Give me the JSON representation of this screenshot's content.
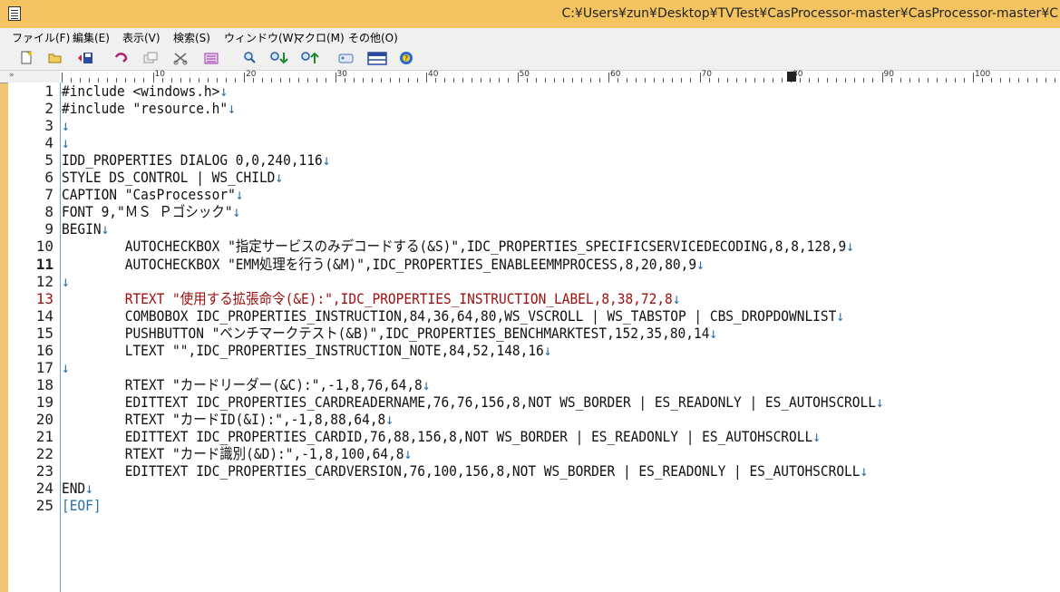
{
  "window": {
    "title": "C:¥Users¥zun¥Desktop¥TVTest¥CasProcessor-master¥CasProcessor-master¥C"
  },
  "menu": [
    {
      "label": "ファイル(F)"
    },
    {
      "label": "編集(E)"
    },
    {
      "label": "表示(V)"
    },
    {
      "label": "検索(S)"
    },
    {
      "label": "ウィンドウ(W)"
    },
    {
      "label": "マクロ(M)"
    },
    {
      "label": "その他(O)"
    }
  ],
  "toolbar": [
    {
      "icon": "new-file-icon"
    },
    {
      "icon": "open-folder-icon"
    },
    {
      "icon": "save-icon"
    },
    {
      "icon": "undo-icon"
    },
    {
      "icon": "copy-icon"
    },
    {
      "icon": "cut-icon"
    },
    {
      "icon": "paste-icon"
    },
    {
      "icon": "search-icon"
    },
    {
      "icon": "search-next-icon"
    },
    {
      "icon": "search-prev-icon"
    },
    {
      "icon": "window-icon"
    },
    {
      "icon": "split-icon"
    },
    {
      "icon": "help-icon"
    }
  ],
  "ruler": {
    "marker": "»",
    "labels": [
      "10",
      "20",
      "30",
      "40",
      "50",
      "60",
      "70",
      "80",
      "90",
      "100"
    ]
  },
  "editor": {
    "lines": [
      {
        "n": "1",
        "text": "#include <windows.h>",
        "eol": "↓"
      },
      {
        "n": "2",
        "text": "#include \"resource.h\"",
        "eol": "↓"
      },
      {
        "n": "3",
        "text": "",
        "eol": "↓"
      },
      {
        "n": "4",
        "text": "",
        "eol": "↓"
      },
      {
        "n": "5",
        "text": "IDD_PROPERTIES DIALOG 0,0,240,116",
        "eol": "↓"
      },
      {
        "n": "6",
        "text": "STYLE DS_CONTROL | WS_CHILD",
        "eol": "↓"
      },
      {
        "n": "7",
        "text": "CAPTION \"CasProcessor\"",
        "eol": "↓"
      },
      {
        "n": "8",
        "text": "FONT 9,\"ＭＳ Ｐゴシック\"",
        "eol": "↓"
      },
      {
        "n": "9",
        "text": "BEGIN",
        "eol": "↓"
      },
      {
        "n": "10",
        "text": "\tAUTOCHECKBOX \"指定サービスのみデコードする(&S)\",IDC_PROPERTIES_SPECIFICSERVICEDECODING,8,8,128,9",
        "eol": "↓"
      },
      {
        "n": "11",
        "text": "\tAUTOCHECKBOX \"EMM処理を行う(&M)\",IDC_PROPERTIES_ENABLEEMMPROCESS,8,20,80,9",
        "eol": "↓"
      },
      {
        "n": "12",
        "text": "",
        "eol": "↓"
      },
      {
        "n": "13",
        "text": "\tRTEXT \"使用する拡張命令(&E):\",IDC_PROPERTIES_INSTRUCTION_LABEL,8,38,72,8",
        "eol": "↓"
      },
      {
        "n": "14",
        "text": "\tCOMBOBOX IDC_PROPERTIES_INSTRUCTION,84,36,64,80,WS_VSCROLL | WS_TABSTOP | CBS_DROPDOWNLIST",
        "eol": "↓"
      },
      {
        "n": "15",
        "text": "\tPUSHBUTTON \"ベンチマークテスト(&B)\",IDC_PROPERTIES_BENCHMARKTEST,152,35,80,14",
        "eol": "↓"
      },
      {
        "n": "16",
        "text": "\tLTEXT \"\",IDC_PROPERTIES_INSTRUCTION_NOTE,84,52,148,16",
        "eol": "↓"
      },
      {
        "n": "17",
        "text": "",
        "eol": "↓"
      },
      {
        "n": "18",
        "text": "\tRTEXT \"カードリーダー(&C):\",-1,8,76,64,8",
        "eol": "↓"
      },
      {
        "n": "19",
        "text": "\tEDITTEXT IDC_PROPERTIES_CARDREADERNAME,76,76,156,8,NOT WS_BORDER | ES_READONLY | ES_AUTOHSCROLL",
        "eol": "↓"
      },
      {
        "n": "20",
        "text": "\tRTEXT \"カードID(&I):\",-1,8,88,64,8",
        "eol": "↓"
      },
      {
        "n": "21",
        "text": "\tEDITTEXT IDC_PROPERTIES_CARDID,76,88,156,8,NOT WS_BORDER | ES_READONLY | ES_AUTOHSCROLL",
        "eol": "↓"
      },
      {
        "n": "22",
        "text": "\tRTEXT \"カード識別(&D):\",-1,8,100,64,8",
        "eol": "↓"
      },
      {
        "n": "23",
        "text": "\tEDITTEXT IDC_PROPERTIES_CARDVERSION,76,100,156,8,NOT WS_BORDER | ES_READONLY | ES_AUTOHSCROLL",
        "eol": "↓"
      },
      {
        "n": "24",
        "text": "END",
        "eol": "↓"
      },
      {
        "n": "25",
        "text": "",
        "eol": "[EOF]"
      }
    ],
    "highlight_line": "13",
    "cursor_line": "11"
  },
  "colors": {
    "titlebar": "#f3c45f",
    "eol_mark": "#2c70a8",
    "highlight_text": "#a01010"
  }
}
